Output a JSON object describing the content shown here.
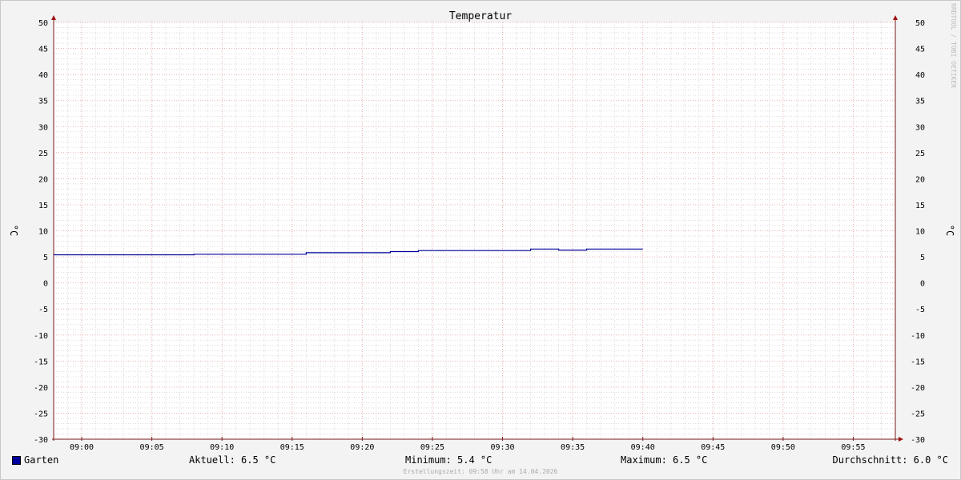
{
  "watermark": "RRDTOOL / TOBI OETIKER",
  "chart_data": {
    "type": "line",
    "title": "Temperatur",
    "ylabel": "°C",
    "ylim": [
      -30,
      50
    ],
    "yticks": [
      50,
      45,
      40,
      35,
      30,
      25,
      20,
      15,
      10,
      5,
      0,
      -5,
      -10,
      -15,
      -20,
      -25,
      -30
    ],
    "xlim": [
      "08:58",
      "09:58"
    ],
    "xticks": [
      "09:00",
      "09:05",
      "09:10",
      "09:15",
      "09:20",
      "09:25",
      "09:30",
      "09:35",
      "09:40",
      "09:45",
      "09:50",
      "09:55"
    ],
    "grid": true,
    "series": [
      {
        "name": "Garten",
        "color": "#00009c",
        "points": [
          [
            "08:58",
            5.4
          ],
          [
            "09:08",
            5.4
          ],
          [
            "09:08",
            5.5
          ],
          [
            "09:16",
            5.5
          ],
          [
            "09:16",
            5.8
          ],
          [
            "09:22",
            5.8
          ],
          [
            "09:22",
            6.0
          ],
          [
            "09:24",
            6.0
          ],
          [
            "09:24",
            6.2
          ],
          [
            "09:32",
            6.2
          ],
          [
            "09:32",
            6.5
          ],
          [
            "09:34",
            6.5
          ],
          [
            "09:34",
            6.3
          ],
          [
            "09:36",
            6.3
          ],
          [
            "09:36",
            6.5
          ],
          [
            "09:40",
            6.5
          ]
        ]
      }
    ]
  },
  "legend": {
    "series_name": "Garten",
    "current": "Aktuell: 6.5 °C",
    "minimum": "Minimum: 5.4 °C",
    "maximum": "Maximum: 6.5 °C",
    "average": "Durchschnitt: 6.0 °C"
  },
  "footer": "Erstellungszeit: 09:58 Uhr am 14.04.2026"
}
